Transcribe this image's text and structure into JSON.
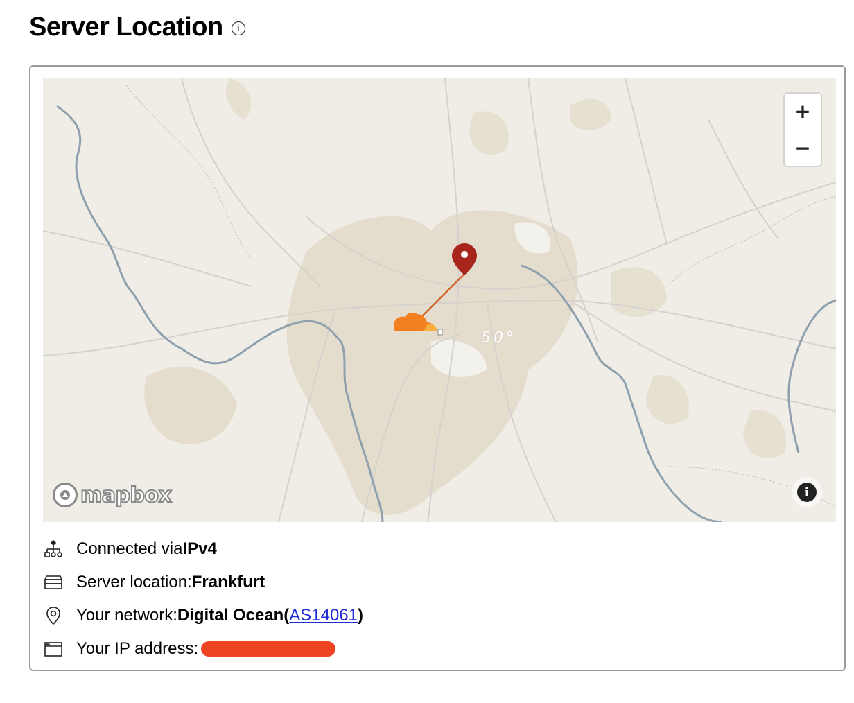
{
  "header": {
    "title": "Server Location",
    "info_icon": "info-circle-icon",
    "info_glyph": "i"
  },
  "map": {
    "zoom_in_label": "+",
    "zoom_out_label": "−",
    "attribution_label": "i",
    "logo_text": "mapbox",
    "degree_label": "50°",
    "marker_color": "#a8251c",
    "cloudflare_color": "#f38020"
  },
  "info": {
    "connection_prefix": "Connected via ",
    "connection_value": "IPv4",
    "location_prefix": "Server location: ",
    "location_value": "Frankfurt",
    "network_prefix": "Your network: ",
    "network_value": "Digital Ocean",
    "network_paren_open": " (",
    "network_asn": "AS14061",
    "network_paren_close": ")",
    "ip_prefix": "Your IP address:"
  },
  "colors": {
    "redaction": "#ee4423",
    "link": "#1f2bd6",
    "map_background": "#efede6"
  }
}
